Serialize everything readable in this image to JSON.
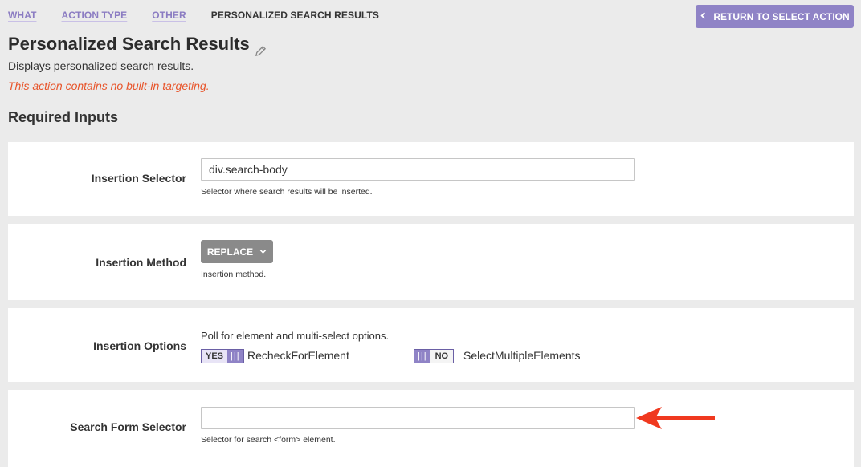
{
  "breadcrumb": {
    "items": [
      "WHAT",
      "ACTION TYPE",
      "OTHER",
      "PERSONALIZED SEARCH RESULTS"
    ]
  },
  "header": {
    "return_button": "RETURN TO SELECT ACTION",
    "title": "Personalized Search Results",
    "description": "Displays personalized search results.",
    "warning": "This action contains no built-in targeting."
  },
  "section": {
    "heading": "Required Inputs"
  },
  "fields": {
    "insertion_selector": {
      "label": "Insertion Selector",
      "value": "div.search-body",
      "help": "Selector where search results will be inserted."
    },
    "insertion_method": {
      "label": "Insertion Method",
      "value": "REPLACE",
      "help": "Insertion method."
    },
    "insertion_options": {
      "label": "Insertion Options",
      "help": "Poll for element and multi-select options.",
      "recheck": {
        "state": "YES",
        "label": "RecheckForElement"
      },
      "select_multiple": {
        "state": "NO",
        "label": "SelectMultipleElements"
      }
    },
    "search_form_selector": {
      "label": "Search Form Selector",
      "value": "",
      "help": "Selector for search <form> element."
    }
  },
  "colors": {
    "accent": "#8f83c6",
    "warning": "#e8552b",
    "arrow": "#f0391f",
    "background": "#ebebeb"
  },
  "icons": {
    "edit": "pencil-icon",
    "back": "chevron-left-icon",
    "dropdown": "chevron-down-icon",
    "annotation": "red-arrow-icon"
  }
}
